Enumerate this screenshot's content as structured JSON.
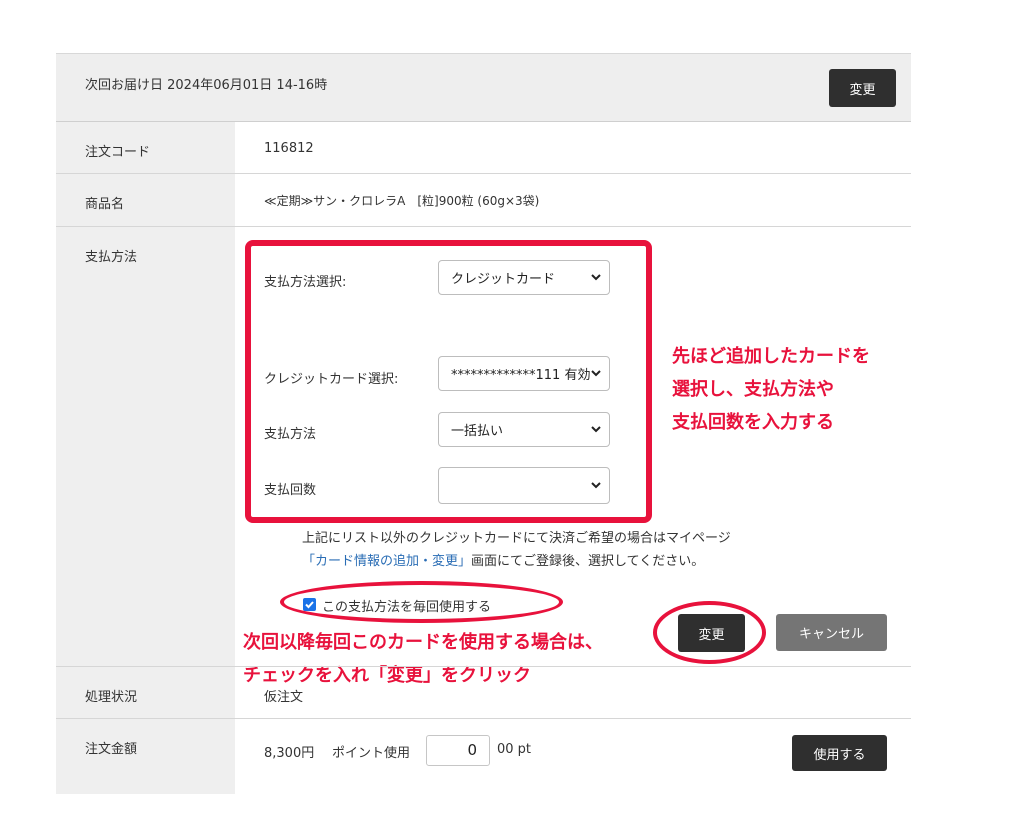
{
  "header": {
    "delivery_text": "次回お届け日 2024年06月01日 14-16時",
    "change_button": "変更"
  },
  "order": {
    "code_label": "注文コード",
    "code_value": "116812",
    "product_label": "商品名",
    "product_value": "≪定期≫サン・クロレラA　[粒]900粒 (60g×3袋)",
    "payment_label": "支払方法",
    "status_label": "処理状況",
    "status_value": "仮注文",
    "amount_label": "注文金額",
    "amount_value": "8,300円",
    "points_label": "ポイント使用",
    "points_value": "0",
    "points_unit": "00 pt",
    "use_button": "使用する"
  },
  "payment_form": {
    "method_select_label": "支払方法選択:",
    "method_select_value": "クレジットカード",
    "card_select_label": "クレジットカード選択:",
    "card_select_value": "*************111 有効",
    "pay_type_label": "支払方法",
    "pay_type_value": "一括払い",
    "installments_label": "支払回数",
    "installments_value": "",
    "note_line1": "上記にリスト以外のクレジットカードにて決済ご希望の場合はマイページ",
    "note_link": "「カード情報の追加・変更」",
    "note_line2_rest": "画面にてご登録後、選択してください。",
    "checkbox_label": "この支払方法を毎回使用する",
    "checkbox_checked": true,
    "change_button": "変更",
    "cancel_button": "キャンセル"
  },
  "annotations": {
    "right_line1": "先ほど追加したカードを",
    "right_line2": "選択し、支払方法や",
    "right_line3": "支払回数を入力する",
    "bottom_line1": "次回以降毎回このカードを使用する場合は、",
    "bottom_line2": "チェックを入れ「変更」をクリック"
  },
  "colors": {
    "annotation_red": "#e8123c",
    "dark_button": "#2f2f2f",
    "cancel_button": "#757575",
    "link_blue": "#2a6db5",
    "checkbox_blue": "#1a73e8"
  },
  "icons": [
    "chevron-down-icon",
    "checkmark-icon"
  ]
}
